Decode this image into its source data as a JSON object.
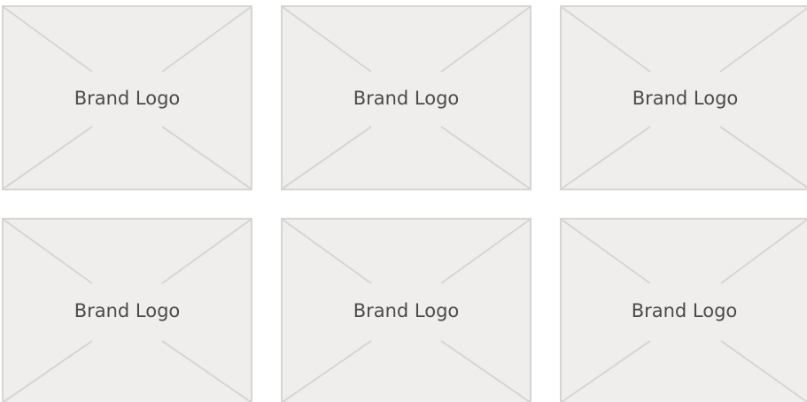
{
  "logo_grid": {
    "items": [
      {
        "label": "Brand Logo"
      },
      {
        "label": "Brand Logo"
      },
      {
        "label": "Brand Logo"
      },
      {
        "label": "Brand Logo"
      },
      {
        "label": "Brand Logo"
      },
      {
        "label": "Brand Logo"
      }
    ]
  },
  "colors": {
    "card_background": "#efeeed",
    "card_border": "#d6d5d3",
    "label_text": "#4a4a4a",
    "page_background": "#ffffff"
  }
}
